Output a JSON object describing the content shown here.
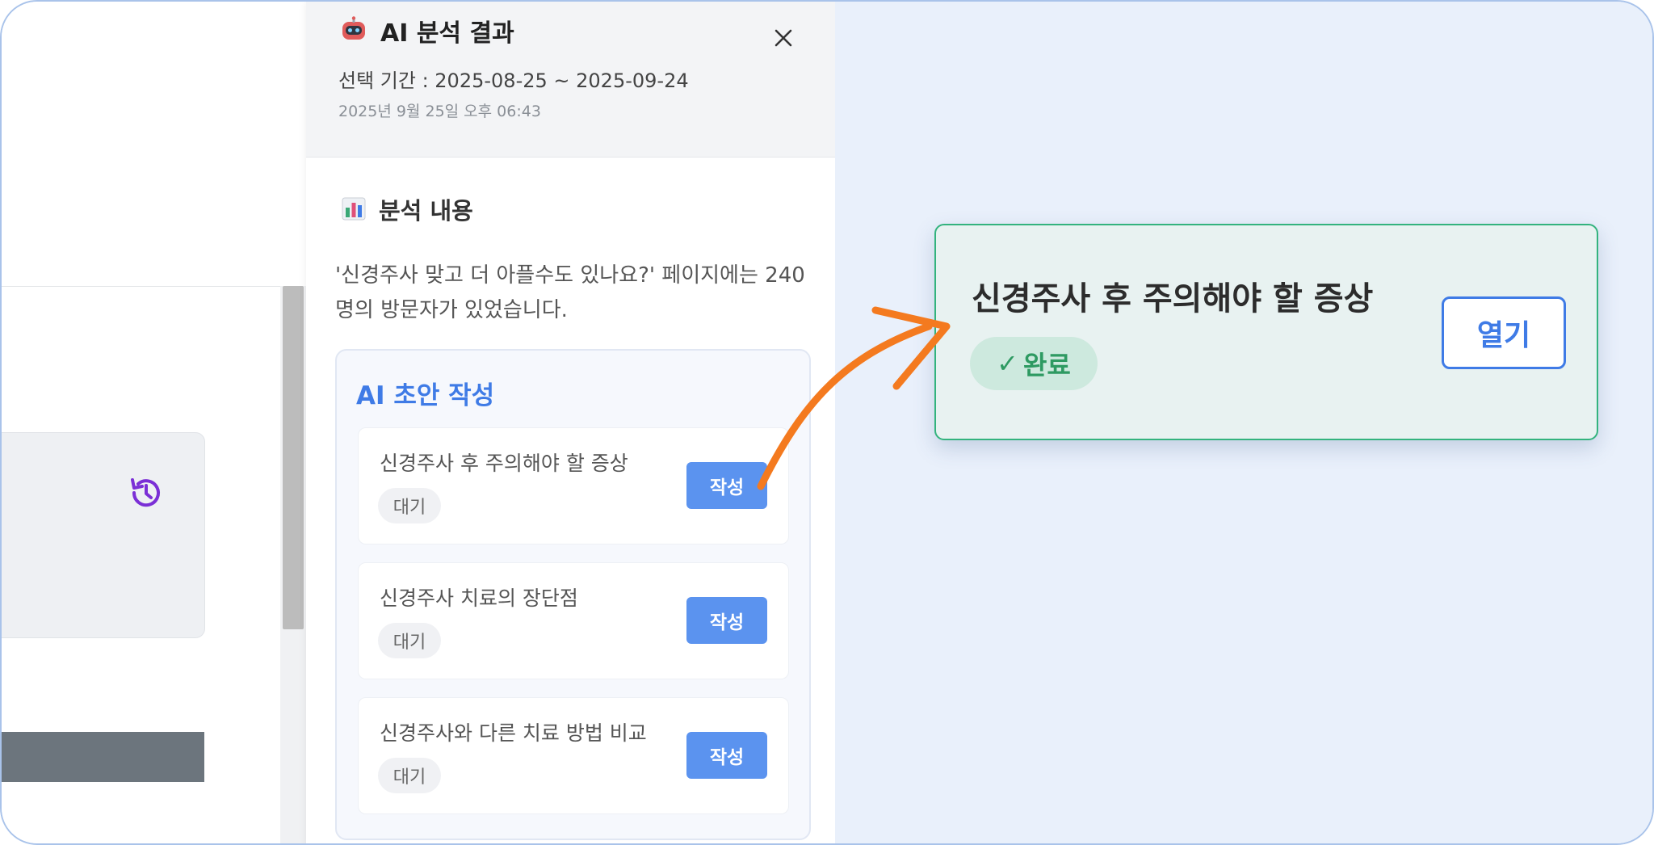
{
  "panel": {
    "title": "AI 분석 결과",
    "period": "선택 기간 : 2025-08-25 ~ 2025-09-24",
    "created_at": "2025년 9월 25일 오후 06:43",
    "section_title": "분석 내용",
    "description": "'신경주사 맞고 더 아플수도 있나요?' 페이지에는 240명의 방문자가 있었습니다.",
    "draft": {
      "title": "AI 초안 작성",
      "items": [
        {
          "title": "신경주사 후 주의해야 할 증상",
          "status": "대기",
          "button": "작성"
        },
        {
          "title": "신경주사 치료의 장단점",
          "status": "대기",
          "button": "작성"
        },
        {
          "title": "신경주사와 다른 치료 방법 비교",
          "status": "대기",
          "button": "작성"
        }
      ]
    }
  },
  "result_card": {
    "title": "신경주사 후 주의해야 할 증상",
    "status_mark": "✓",
    "status": "완료",
    "open_button": "열기"
  },
  "colors": {
    "accent": "#3f7be6",
    "button": "#5b93ef",
    "success": "#33b37e",
    "arrow": "#f47a1f",
    "history_icon": "#7b2fd6"
  },
  "icons": [
    "robot-icon",
    "close-icon",
    "bar-chart-icon",
    "history-icon",
    "arrow-icon",
    "check-icon"
  ]
}
